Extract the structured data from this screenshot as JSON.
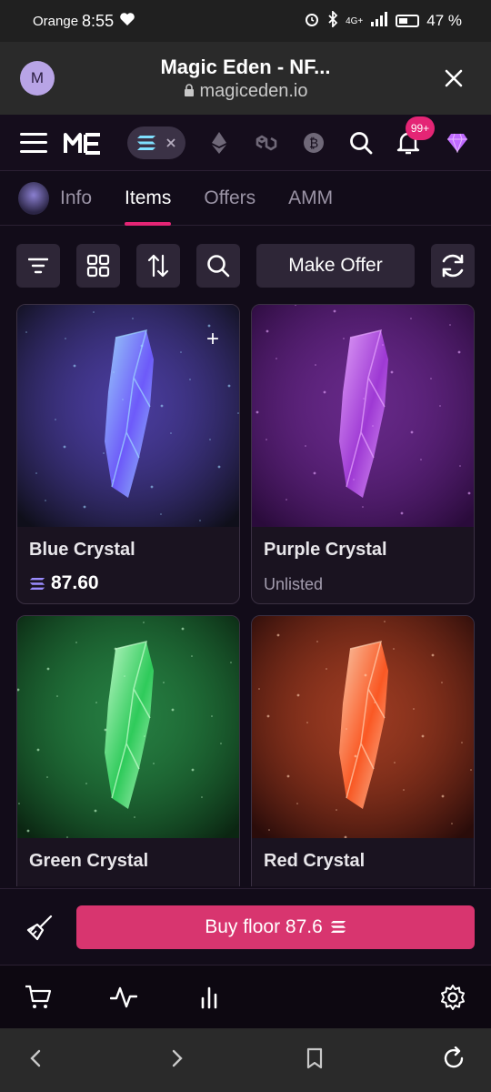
{
  "status": {
    "carrier": "Orange",
    "time": "8:55",
    "network": "4G+",
    "battery": "47 %"
  },
  "browser": {
    "avatar_letter": "M",
    "title": "Magic Eden - NF...",
    "url": "magiceden.io"
  },
  "header": {
    "notification_count": "99+"
  },
  "tabs": [
    {
      "label": "Info"
    },
    {
      "label": "Items"
    },
    {
      "label": "Offers"
    },
    {
      "label": "AMM"
    }
  ],
  "toolbar": {
    "make_offer_label": "Make Offer"
  },
  "items": [
    {
      "name": "Blue Crystal",
      "price": "87.60",
      "colors": [
        "#9fd8ff",
        "#6f5cff",
        "#0f0f1a"
      ]
    },
    {
      "name": "Purple Crystal",
      "status": "Unlisted",
      "colors": [
        "#e7a7ff",
        "#a13ad8",
        "#2a0b3b"
      ]
    },
    {
      "name": "Green Crystal",
      "colors": [
        "#c9ffd0",
        "#2fcf5c",
        "#0b2612"
      ]
    },
    {
      "name": "Red Crystal",
      "colors": [
        "#ffd0b0",
        "#ff5a24",
        "#2a0c0a"
      ]
    }
  ],
  "buy": {
    "label": "Buy floor 87.6"
  },
  "accent": "#d8356f"
}
